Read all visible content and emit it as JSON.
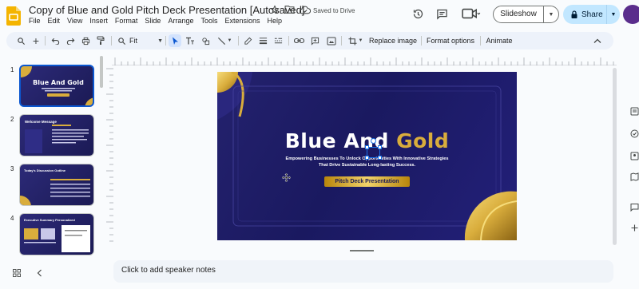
{
  "app": {
    "title": "Copy of Blue and Gold Pitch Deck Presentation [Autosaved]",
    "saved_status": "Saved to Drive",
    "menu": [
      "File",
      "Edit",
      "View",
      "Insert",
      "Format",
      "Slide",
      "Arrange",
      "Tools",
      "Extensions",
      "Help"
    ]
  },
  "header": {
    "slideshow_label": "Slideshow",
    "share_label": "Share"
  },
  "toolbar": {
    "zoom": "Fit",
    "replace_image": "Replace image",
    "format_options": "Format options",
    "animate": "Animate"
  },
  "filmstrip": {
    "slides": [
      {
        "number": "1",
        "title": "Blue And Gold",
        "selected": true
      },
      {
        "number": "2",
        "title": "Welcome Message",
        "selected": false
      },
      {
        "number": "3",
        "title": "Today's Discussion Outline",
        "selected": false
      },
      {
        "number": "4",
        "title": "Executive Summary Personalized",
        "selected": false
      }
    ]
  },
  "slide": {
    "title_white": "Blue And",
    "title_gold": "Gold",
    "subtitle": "Empowering Businesses To Unlock Opportunities With Innovative Strategies That Drive Sustainable Long-lasting Success.",
    "pill_label": "Pitch Deck Presentation"
  },
  "notes": {
    "placeholder": "Click to add speaker notes"
  },
  "colors": {
    "slide_bg": "#1b1a5e",
    "gold": "#d9ad3c",
    "share_bg": "#c2e7ff",
    "selection": "#0b57d0"
  }
}
